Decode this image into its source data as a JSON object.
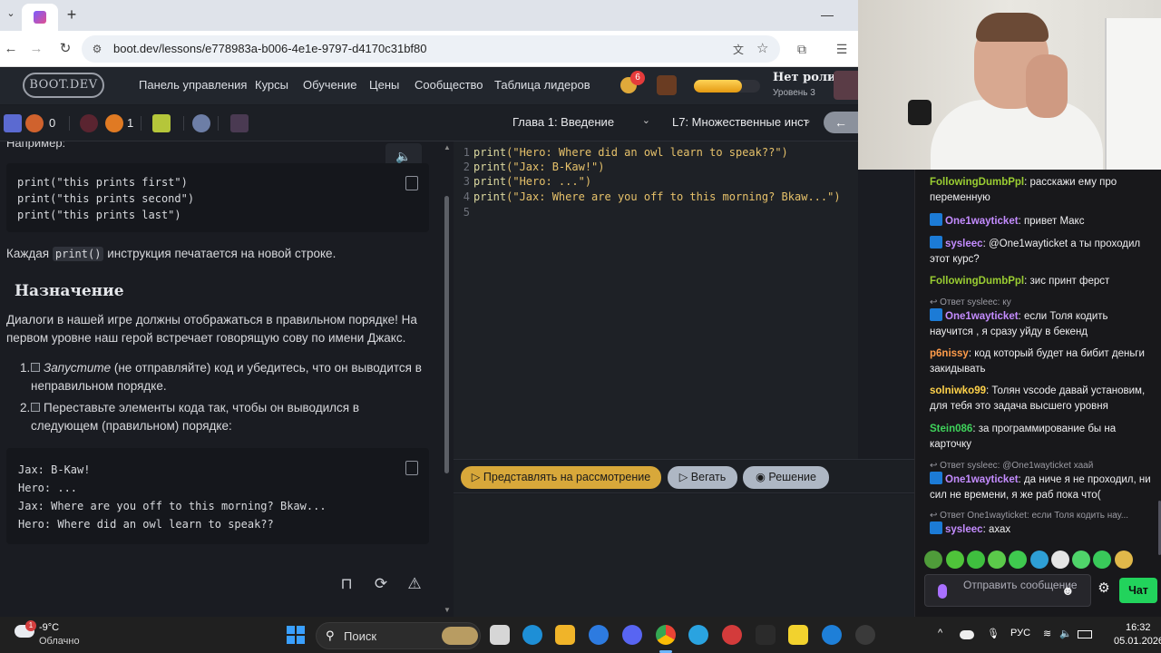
{
  "browser": {
    "url": "boot.dev/lessons/e778983a-b006-4e1e-9797-d4170c31bf80",
    "new_tab_symbol": "+",
    "minimize_symbol": "—"
  },
  "header": {
    "logo": "BOOT.DEV",
    "nav": [
      "Панель управления",
      "Курсы",
      "Обучение",
      "Цены",
      "Сообщество",
      "Таблица лидеров"
    ],
    "notification_count": "6",
    "user_role": "Нет роли",
    "user_level": "Уровень 3",
    "xp_progress": 0.72
  },
  "lesson_bar": {
    "gems": "0",
    "flames": "1",
    "chapter": "Глава 1: Введение",
    "lesson": "L7: Множественные инст",
    "back_symbol": "←"
  },
  "lesson": {
    "cut_text": "Например:",
    "code_block_1": [
      "print(\"this prints first\")",
      "print(\"this prints second\")",
      "print(\"this prints last\")"
    ],
    "para_each_before": "Каждая",
    "para_each_code": "print()",
    "para_each_after": "инструкция печатается на новой строке.",
    "heading": "Назначение",
    "para_dialog": "Диалоги в нашей игре должны отображаться в правильном порядке! На первом уровне наш герой встречает говорящую сову по имени Джакс.",
    "item_1_num": "1.",
    "item_1_italic": "Запустите",
    "item_1_rest": "(не отправляйте) код и убедитесь, что он выводится в неправильном порядке.",
    "item_2_num": "2.",
    "item_2_text": "Переставьте элементы кода так, чтобы он выводился в следующем (правильном) порядке:",
    "code_block_2": [
      "Jax: B-Kaw!",
      "Hero: ...",
      "Jax: Where are you off to this morning? Bkaw...",
      "Hero: Where did an owl learn to speak??"
    ]
  },
  "editor": {
    "lines": [
      {
        "n": "1",
        "fn": "print",
        "arg": "(\"Hero: Where did an owl learn to speak??\")"
      },
      {
        "n": "2",
        "fn": "print",
        "arg": "(\"Jax: B-Kaw!\")"
      },
      {
        "n": "3",
        "fn": "print",
        "arg": "(\"Hero: ...\")"
      },
      {
        "n": "4",
        "fn": "print",
        "arg": "(\"Jax: Where are you off to this morning? Bkaw...\")"
      },
      {
        "n": "5",
        "fn": "",
        "arg": ""
      }
    ]
  },
  "actions": {
    "submit": "▷ Представлять на рассмотрение",
    "run": "▷ Вегать",
    "solution": "◉ Решение"
  },
  "chat": {
    "messages": [
      {
        "user": "FollowingDumbPpl",
        "color": "#9acd32",
        "text": "расскажи ему про переменную",
        "badge": false
      },
      {
        "user": "One1wayticket",
        "color": "#c48cff",
        "text": "привет Макс",
        "badge": true
      },
      {
        "user": "sysleec",
        "color": "#c48cff",
        "text": "@One1wayticket а ты проходил этот курс?",
        "badge": true
      },
      {
        "user": "FollowingDumbPpl",
        "color": "#9acd32",
        "text": "зис принт ферст",
        "badge": false
      },
      {
        "reply": "↩ Ответ sysleec: ку"
      },
      {
        "user": "One1wayticket",
        "color": "#c48cff",
        "text": "если Толя кодить научится , я сразу уйду в бекенд",
        "badge": true
      },
      {
        "user": "p6nissy",
        "color": "#ff9c4a",
        "text": "код который будет на бибит деньги закидывать",
        "badge": false
      },
      {
        "user": "solniwko99",
        "color": "#ffd24a",
        "text": "Толян vscode давай установим, для тебя это задача высшего уровня",
        "badge": false
      },
      {
        "user": "Stein086",
        "color": "#3fd35b",
        "text": "за программирование бы на карточку",
        "badge": false
      },
      {
        "reply": "↩ Ответ sysleec: @One1wayticket хаай"
      },
      {
        "user": "One1wayticket",
        "color": "#c48cff",
        "text": "да ниче я не проходил, ни сил не времени, я же раб пока что(",
        "badge": true
      },
      {
        "reply": "↩ Ответ One1wayticket: если Толя кодить нау..."
      },
      {
        "user": "sysleec",
        "color": "#c48cff",
        "text": "ахах",
        "badge": true
      }
    ],
    "input_placeholder": "Отправить сообщение",
    "send_label": "Чат"
  },
  "taskbar": {
    "weather_temp": "-9°C",
    "weather_desc": "Облачно",
    "weather_badge": "1",
    "search_label": "Поиск",
    "language": "РУС",
    "time": "16:32",
    "date": "05.01.2026"
  }
}
